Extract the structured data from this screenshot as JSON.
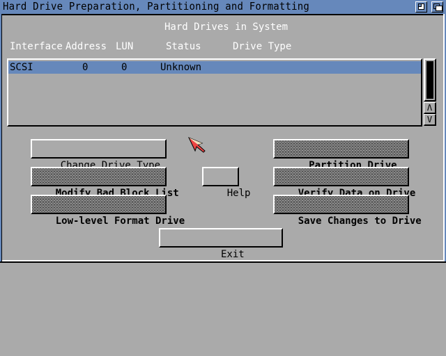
{
  "window": {
    "title": "Hard Drive Preparation, Partitioning and Formatting",
    "gadgets": [
      {
        "name": "zoom-gadget",
        "icon": "zoom-icon"
      },
      {
        "name": "depth-gadget",
        "icon": "depth-icon"
      }
    ]
  },
  "drives": {
    "heading": "Hard Drives in System",
    "columns": [
      "Interface",
      "Address",
      "LUN",
      "Status",
      "Drive Type"
    ],
    "rows": [
      {
        "interface": "SCSI",
        "address": "0",
        "lun": "0",
        "status": "Unknown",
        "drive_type": "",
        "selected": true
      }
    ],
    "scroll": {
      "up_label": "^",
      "down_label": "v"
    }
  },
  "buttons": {
    "change_drive_type": {
      "label": "Change Drive Type",
      "enabled": true
    },
    "modify_bad_block_list": {
      "label": "Modify Bad Block List",
      "enabled": false
    },
    "low_level_format": {
      "label": "Low-level Format Drive",
      "enabled": false
    },
    "help": {
      "label": "Help",
      "enabled": true
    },
    "partition_drive": {
      "label": "Partition Drive",
      "enabled": false
    },
    "verify_data": {
      "label": "Verify Data on Drive",
      "enabled": false
    },
    "save_changes": {
      "label": "Save Changes to Drive",
      "enabled": false
    },
    "exit": {
      "label": "Exit",
      "enabled": true
    }
  },
  "colors": {
    "titlebar": "#6688bb",
    "background": "#aaaaaa",
    "selection": "#6688bb",
    "pointer": "#ee4444"
  }
}
